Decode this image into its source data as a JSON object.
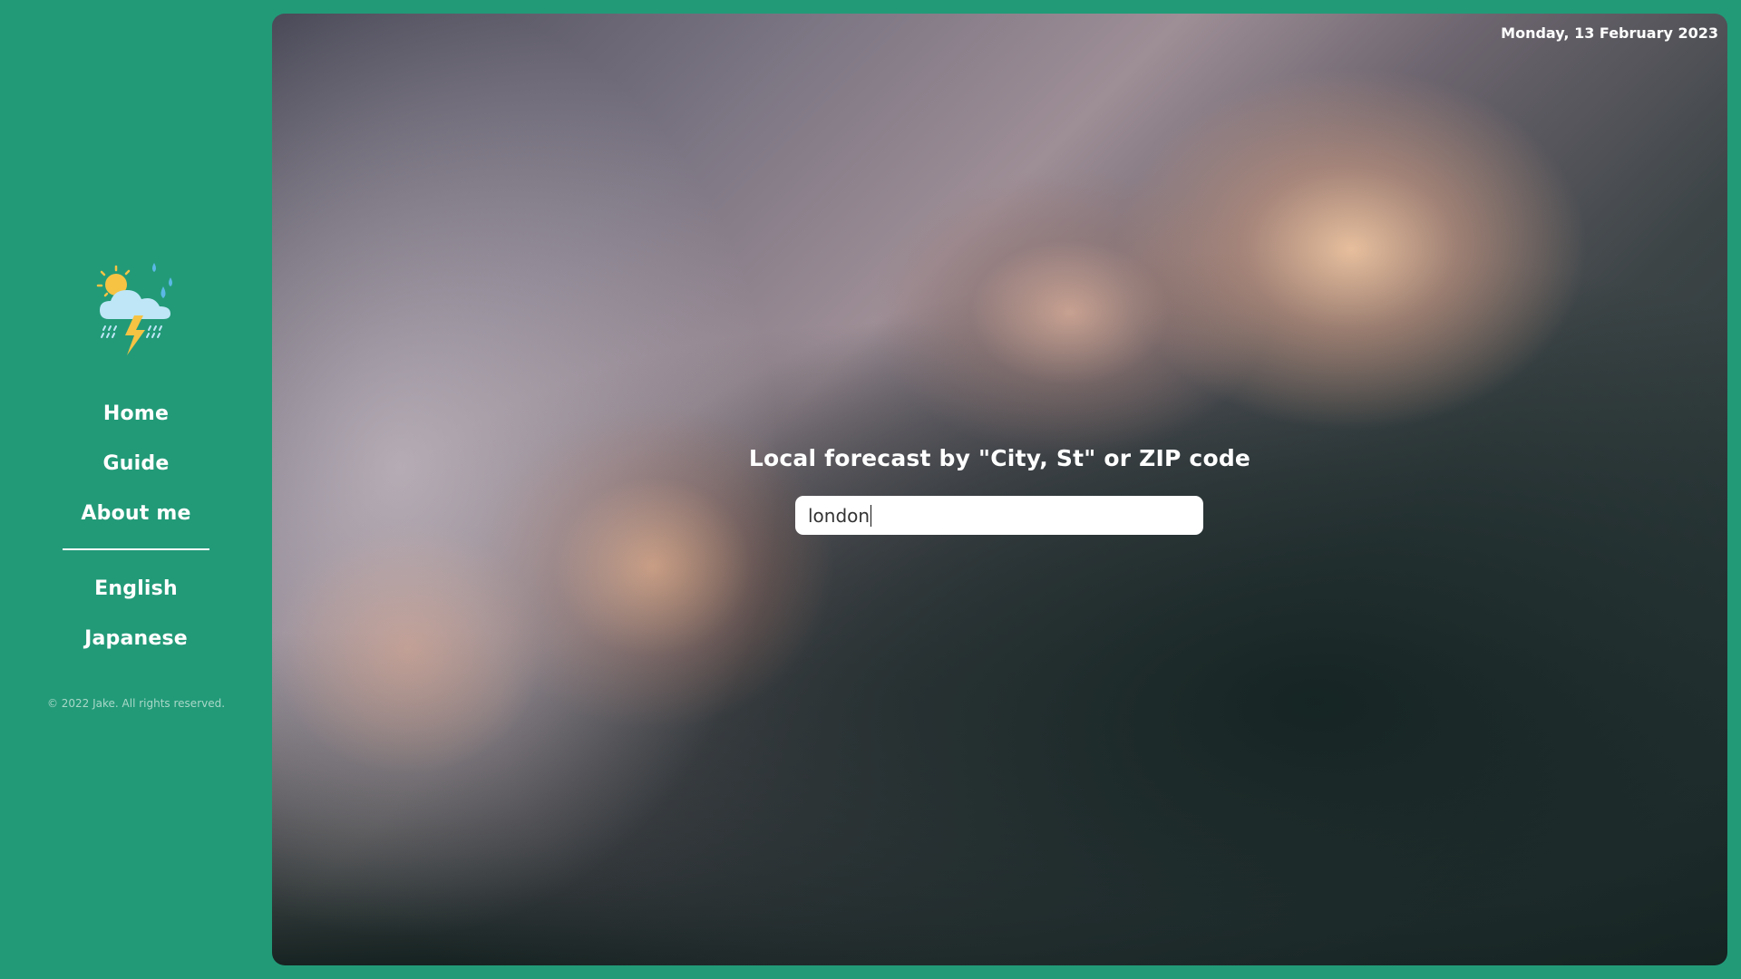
{
  "sidebar": {
    "logo_icon": "weather-thunderstorm-icon",
    "nav_items": [
      {
        "label": "Home"
      },
      {
        "label": "Guide"
      },
      {
        "label": "About me"
      }
    ],
    "language_items": [
      {
        "label": "English"
      },
      {
        "label": "Japanese"
      }
    ],
    "copyright": "© 2022 Jake. All rights reserved."
  },
  "main": {
    "date": "Monday, 13 February 2023",
    "prompt": "Local forecast by \"City, St\" or ZIP code",
    "search": {
      "value": "london"
    }
  },
  "colors": {
    "sidebar_bg": "#229a78",
    "text": "#ffffff"
  }
}
